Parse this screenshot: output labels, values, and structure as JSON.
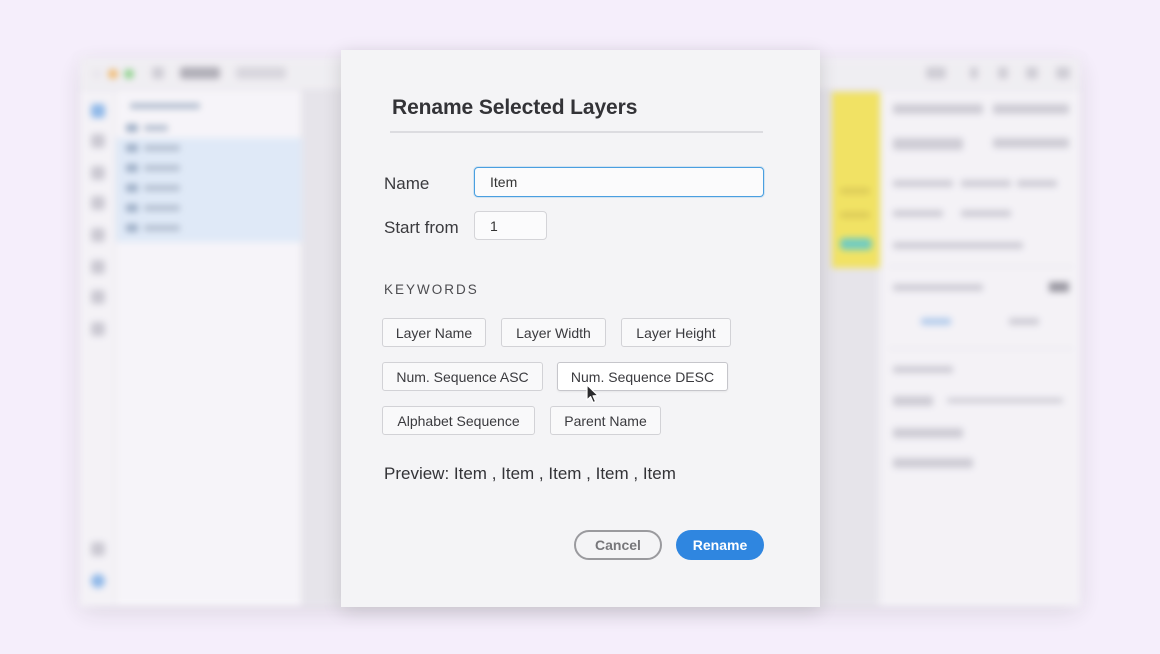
{
  "dialog": {
    "title": "Rename Selected Layers",
    "name_label": "Name",
    "name_value": "Item",
    "start_label": "Start from",
    "start_value": "1",
    "keywords_label": "KEYWORDS",
    "keywords": [
      "Layer Name",
      "Layer Width",
      "Layer Height",
      "Num. Sequence ASC",
      "Num. Sequence DESC",
      "Alphabet Sequence",
      "Parent Name"
    ],
    "hovered_keyword": "Num. Sequence DESC",
    "preview": "Preview: Item , Item , Item , Item , Item",
    "cancel_label": "Cancel",
    "rename_label": "Rename"
  },
  "colors": {
    "accent": "#2f86e0",
    "input_focus": "#4a9fe0",
    "backdrop": "#f5eefb",
    "dialog_bg": "#f4f4f6",
    "canvas_artboard": "#f1e14a"
  },
  "icons": {
    "pointer": "mouse-pointer-icon"
  }
}
